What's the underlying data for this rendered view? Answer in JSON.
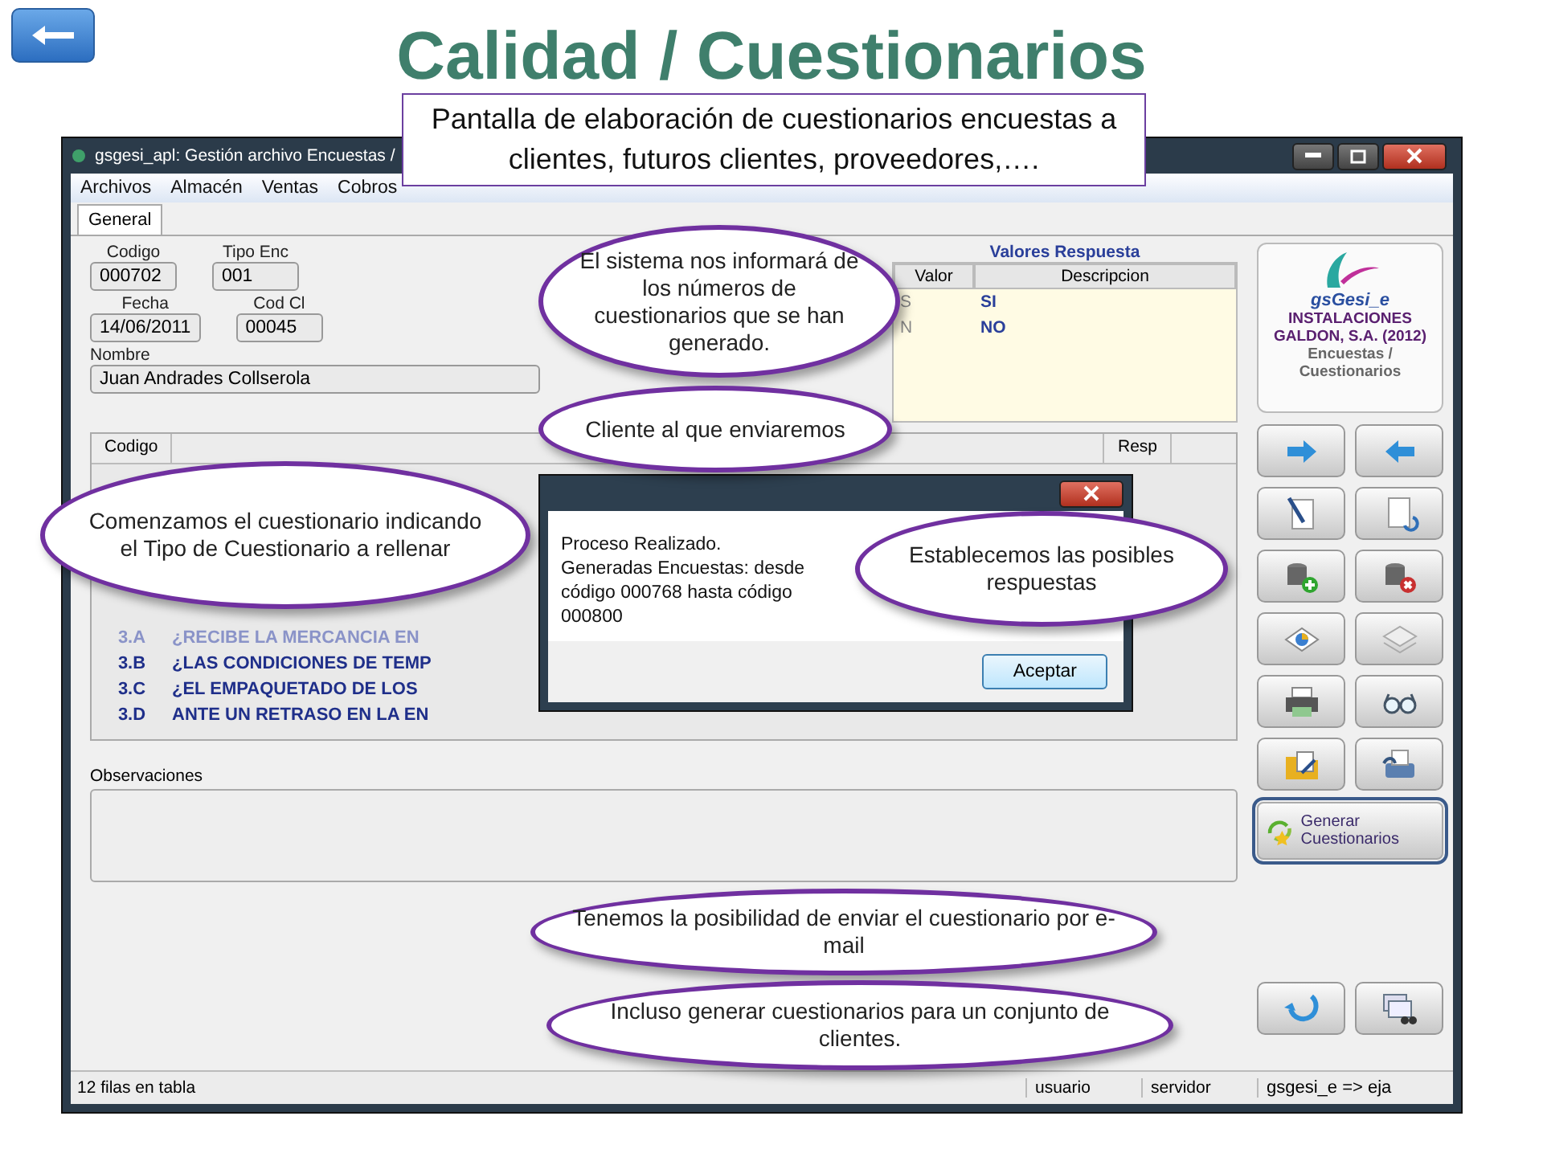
{
  "title": "Calidad / Cuestionarios",
  "intro": "Pantalla de elaboración de cuestionarios encuestas a clientes, futuros clientes, proveedores,….",
  "window": {
    "title": "gsgesi_apl: Gestión archivo Encuestas /",
    "menu": [
      "Archivos",
      "Almacén",
      "Ventas",
      "Cobros"
    ],
    "tabs": [
      {
        "label": "General",
        "selected": true
      }
    ],
    "form_rows": [
      [
        {
          "label": "Codigo",
          "value": "000702"
        },
        {
          "label": "Tipo Enc",
          "value": "001"
        }
      ],
      [
        {
          "label": "Fecha",
          "value": "14/06/2011"
        },
        {
          "label": "Cod Cl",
          "value": "00045"
        }
      ],
      [
        {
          "label": "Nombre",
          "value": "Juan Andrades Collserola"
        }
      ]
    ],
    "answers": {
      "title": "Valores Respuesta",
      "columns": [
        "Valor",
        "Descripcion"
      ],
      "rows": [
        [
          "S",
          "SI"
        ],
        [
          "N",
          "NO"
        ]
      ]
    },
    "questions": {
      "columns": [
        "Codigo",
        "Resp"
      ],
      "rows": [
        {
          "code": "3.A",
          "text": "¿RECIBE LA MERCANCIA EN",
          "faded": true
        },
        {
          "code": "3.B",
          "text": "¿LAS CONDICIONES DE TEMP",
          "faded": false
        },
        {
          "code": "3.C",
          "text": "¿EL EMPAQUETADO DE LOS",
          "faded": false
        },
        {
          "code": "3.D",
          "text": "ANTE UN RETRASO EN LA EN",
          "faded": false
        }
      ]
    },
    "observations_label": "Observaciones",
    "status": [
      "12 filas en tabla",
      "usuario",
      "servidor",
      "gsgesi_e => eja"
    ]
  },
  "panel": {
    "brand": "gsGesi_e",
    "company": "INSTALACIONES GALDON, S.A. (2012)",
    "module": "Encuestas / Cuestionarios",
    "generate_button": {
      "label": "Generar Cuestionarios",
      "selected": true
    }
  },
  "dialog": {
    "lines": [
      "Proceso Realizado.",
      "Generadas Encuestas: desde código 000768 hasta código 000800"
    ],
    "button": "Aceptar"
  },
  "callouts": [
    {
      "text": "El sistema nos informará de los números de cuestionarios que se han generado."
    },
    {
      "text": "Comenzamos el cuestionario indicando el Tipo de Cuestionario a rellenar"
    },
    {
      "text": "Cliente al que enviaremos"
    },
    {
      "text": "Establecemos las posibles respuestas"
    },
    {
      "text": "Tenemos la posibilidad de enviar el cuestionario por e-mail"
    },
    {
      "text": "Incluso generar cuestionarios para un conjunto de clientes."
    }
  ]
}
